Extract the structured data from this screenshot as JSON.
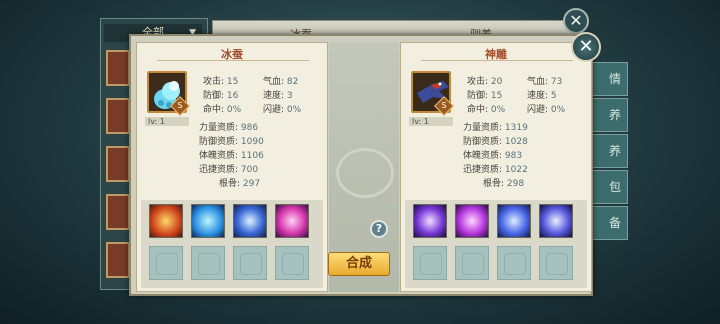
{
  "background": {
    "tab_all": "全部",
    "top_tab_1": "冰蚕",
    "top_tab_2": "驯养",
    "side_tabs": [
      "情",
      "养",
      "养",
      "包",
      "备"
    ]
  },
  "pets": [
    {
      "name": "冰蚕",
      "grade": "S",
      "level": "lv: 1",
      "stats": [
        {
          "label": "攻击:",
          "value": "15"
        },
        {
          "label": "气血:",
          "value": "82"
        },
        {
          "label": "防御:",
          "value": "16"
        },
        {
          "label": "速度:",
          "value": "3"
        },
        {
          "label": "命中:",
          "value": "0%"
        },
        {
          "label": "闪避:",
          "value": "0%"
        }
      ],
      "attributes": [
        {
          "label": "力量资质:",
          "value": "986"
        },
        {
          "label": "防御资质:",
          "value": "1090"
        },
        {
          "label": "体魄资质:",
          "value": "1106"
        },
        {
          "label": "迅捷资质:",
          "value": "700"
        },
        {
          "label": "根骨:",
          "value": "297"
        }
      ],
      "skills": [
        "fire-skill-icon",
        "water-skill-icon",
        "shield-skill-icon",
        "vortex-skill-icon"
      ]
    },
    {
      "name": "神雕",
      "grade": "S",
      "level": "lv: 1",
      "stats": [
        {
          "label": "攻击:",
          "value": "20"
        },
        {
          "label": "气血:",
          "value": "73"
        },
        {
          "label": "防御:",
          "value": "15"
        },
        {
          "label": "速度:",
          "value": "5"
        },
        {
          "label": "命中:",
          "value": "0%"
        },
        {
          "label": "闪避:",
          "value": "0%"
        }
      ],
      "attributes": [
        {
          "label": "力量资质:",
          "value": "1319"
        },
        {
          "label": "防御资质:",
          "value": "1028"
        },
        {
          "label": "体魄资质:",
          "value": "983"
        },
        {
          "label": "迅捷资质:",
          "value": "1022"
        },
        {
          "label": "根骨:",
          "value": "298"
        }
      ],
      "skills": [
        "slash-skill-icon",
        "arrow-skill-icon",
        "dash-skill-icon",
        "claw-skill-icon"
      ]
    }
  ],
  "help_label": "?",
  "merge_label": "合成",
  "close_label": "✕"
}
